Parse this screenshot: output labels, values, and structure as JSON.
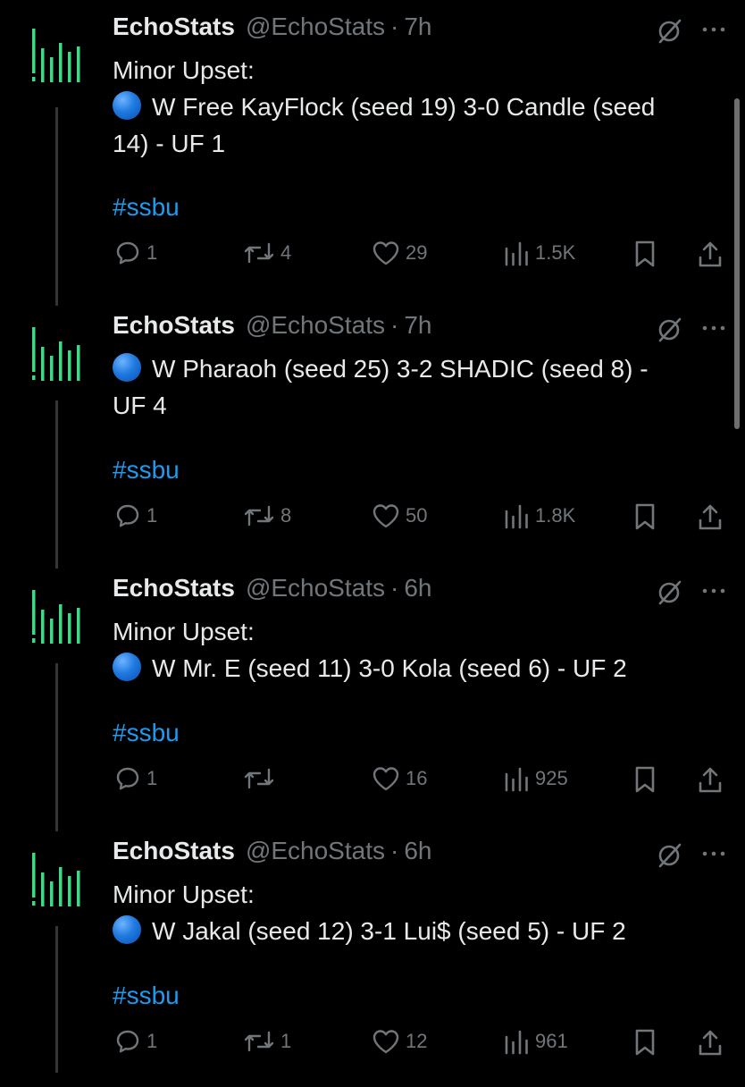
{
  "colors": {
    "background": "#000000",
    "text": "#e7e9ea",
    "muted": "#71767b",
    "link": "#1d9bf0",
    "logo": "#3ddc84"
  },
  "tweets": [
    {
      "name": "EchoStats",
      "handle": "@EchoStats",
      "separator": "·",
      "time": "7h",
      "lines": [
        "Minor Upset:",
        "W Free KayFlock (seed 19) 3-0 Candle (seed",
        "14) - UF 1"
      ],
      "emoji": "blue-circle",
      "hashtag": "#ssbu",
      "replies": "1",
      "reposts": "4",
      "likes": "29",
      "views": "1.5K"
    },
    {
      "name": "EchoStats",
      "handle": "@EchoStats",
      "separator": "·",
      "time": "7h",
      "lines": [
        "W Pharaoh (seed 25) 3-2 SHADIC (seed 8) -",
        "UF 4"
      ],
      "emoji": "blue-circle",
      "hashtag": "#ssbu",
      "replies": "1",
      "reposts": "8",
      "likes": "50",
      "views": "1.8K"
    },
    {
      "name": "EchoStats",
      "handle": "@EchoStats",
      "separator": "·",
      "time": "6h",
      "lines": [
        "Minor Upset:",
        "W Mr. E (seed 11) 3-0 Kola (seed 6) - UF 2"
      ],
      "emoji": "blue-circle",
      "hashtag": "#ssbu",
      "replies": "1",
      "reposts": "",
      "likes": "16",
      "views": "925"
    },
    {
      "name": "EchoStats",
      "handle": "@EchoStats",
      "separator": "·",
      "time": "6h",
      "lines": [
        "Minor Upset:",
        "W Jakal (seed 12) 3-1 Lui$ (seed 5) - UF 2"
      ],
      "emoji": "blue-circle",
      "hashtag": "#ssbu",
      "replies": "1",
      "reposts": "1",
      "likes": "12",
      "views": "961"
    }
  ]
}
